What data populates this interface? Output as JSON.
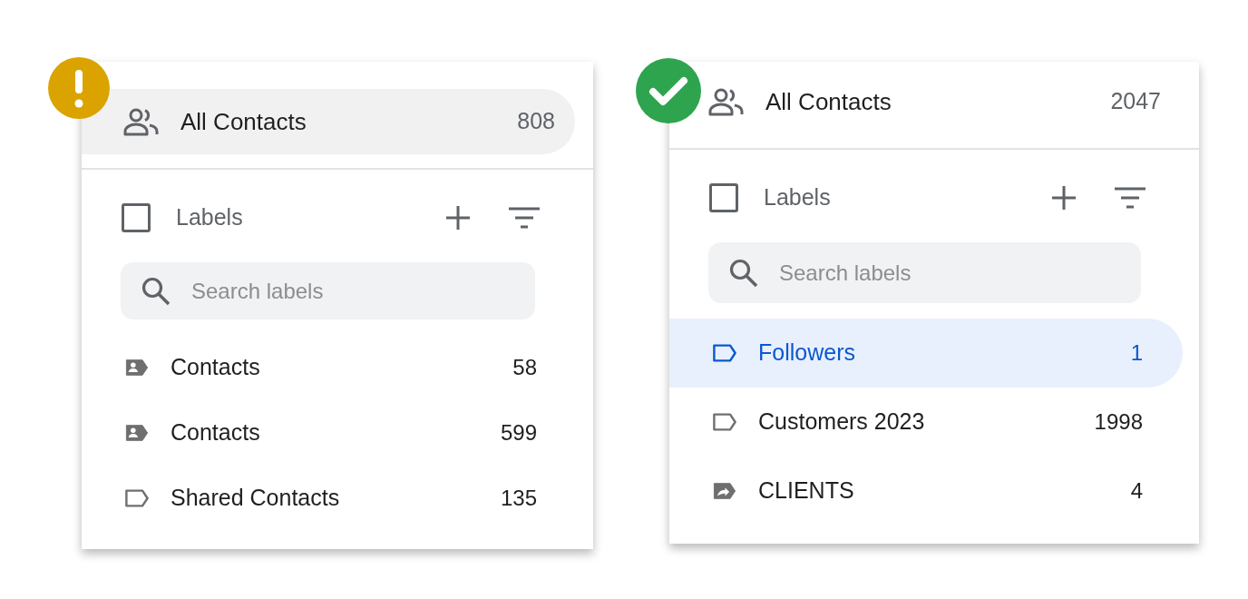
{
  "panels": [
    {
      "status_badge": {
        "kind": "warning"
      },
      "all_contacts": {
        "label": "All Contacts",
        "count": "808",
        "selected": true
      },
      "labels_header": {
        "label": "Labels",
        "checked": false
      },
      "search": {
        "placeholder": "Search labels"
      },
      "labels": [
        {
          "kind": "contact",
          "name": "Contacts",
          "count": "58",
          "selected": false
        },
        {
          "kind": "contact",
          "name": "Contacts",
          "count": "599",
          "selected": false
        },
        {
          "kind": "outline",
          "name": "Shared Contacts",
          "count": "135",
          "selected": false
        }
      ]
    },
    {
      "status_badge": {
        "kind": "success"
      },
      "all_contacts": {
        "label": "All Contacts",
        "count": "2047",
        "selected": false
      },
      "labels_header": {
        "label": "Labels",
        "checked": false
      },
      "search": {
        "placeholder": "Search labels"
      },
      "labels": [
        {
          "kind": "outline",
          "name": "Followers",
          "count": "1",
          "selected": true
        },
        {
          "kind": "outline",
          "name": "Customers 2023",
          "count": "1998",
          "selected": false
        },
        {
          "kind": "shared",
          "name": "CLIENTS",
          "count": "4",
          "selected": false
        }
      ]
    }
  ]
}
